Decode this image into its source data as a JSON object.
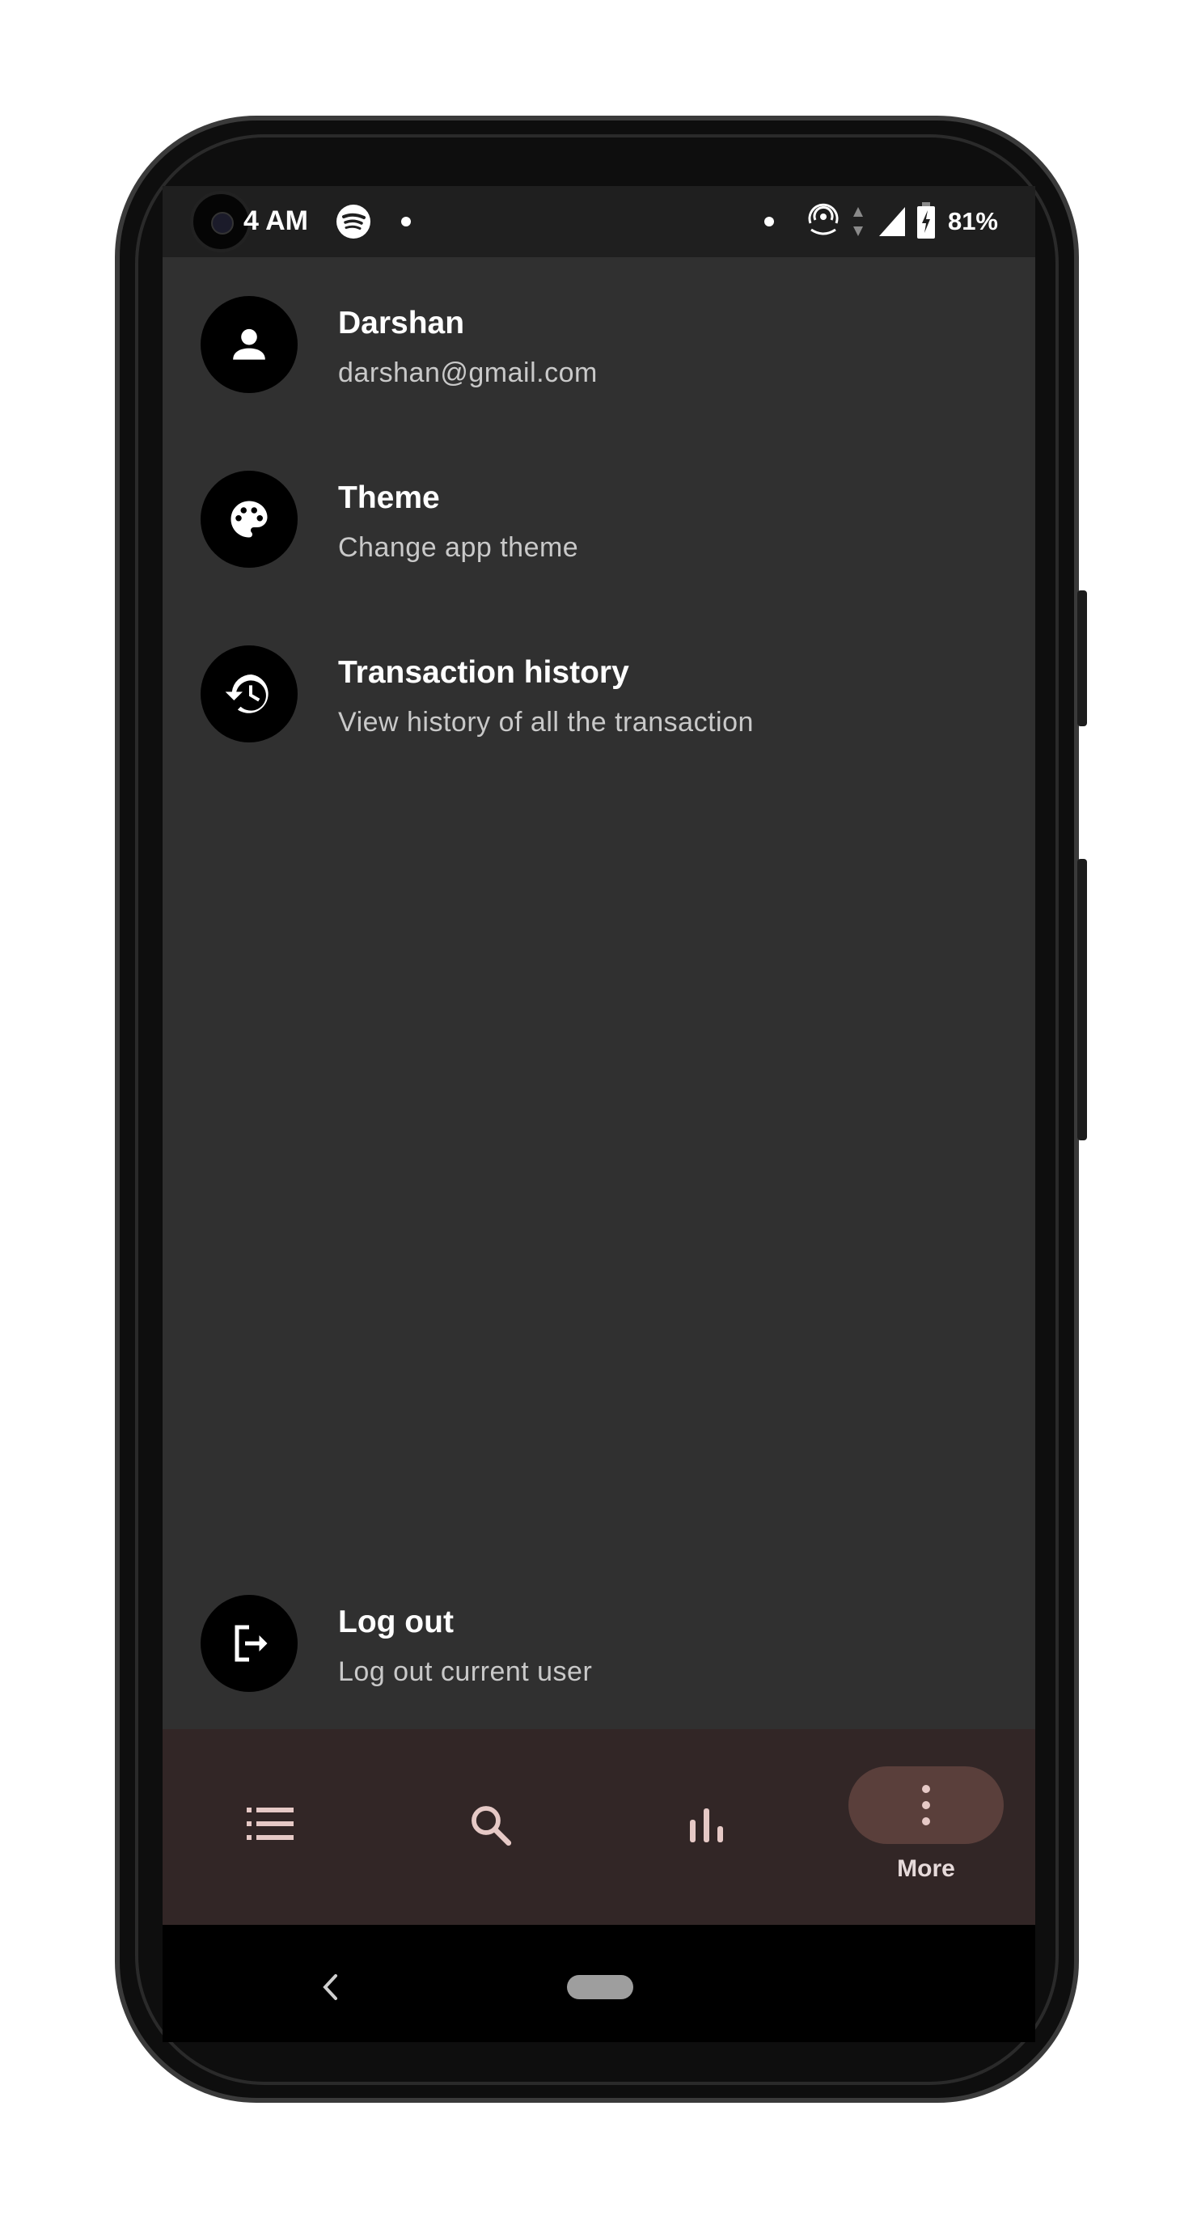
{
  "status_bar": {
    "time": "4 AM",
    "battery_percent": "81%",
    "icons": [
      "spotify-icon",
      "notification-dot-icon",
      "hotspot-icon",
      "data-arrows-icon",
      "signal-icon",
      "battery-charging-icon"
    ]
  },
  "menu": {
    "items": [
      {
        "title": "Darshan",
        "subtitle": "darshan@gmail.com",
        "icon": "person-icon"
      },
      {
        "title": "Theme",
        "subtitle": "Change app theme",
        "icon": "palette-icon"
      },
      {
        "title": "Transaction history",
        "subtitle": "View history of all the transaction",
        "icon": "history-icon"
      }
    ],
    "logout": {
      "title": "Log out",
      "subtitle": "Log out current user",
      "icon": "logout-icon"
    }
  },
  "bottom_nav": {
    "items": [
      {
        "icon": "list-icon"
      },
      {
        "icon": "search-icon"
      },
      {
        "icon": "bar-chart-icon"
      },
      {
        "icon": "more-vert-icon",
        "label": "More",
        "selected": true
      }
    ]
  },
  "colors": {
    "background": "#303030",
    "status_bar": "#1f1f1f",
    "nav_bar": "#322626",
    "nav_selected_pill": "#5a3f3b",
    "nav_icon": "#e6c9c6"
  }
}
